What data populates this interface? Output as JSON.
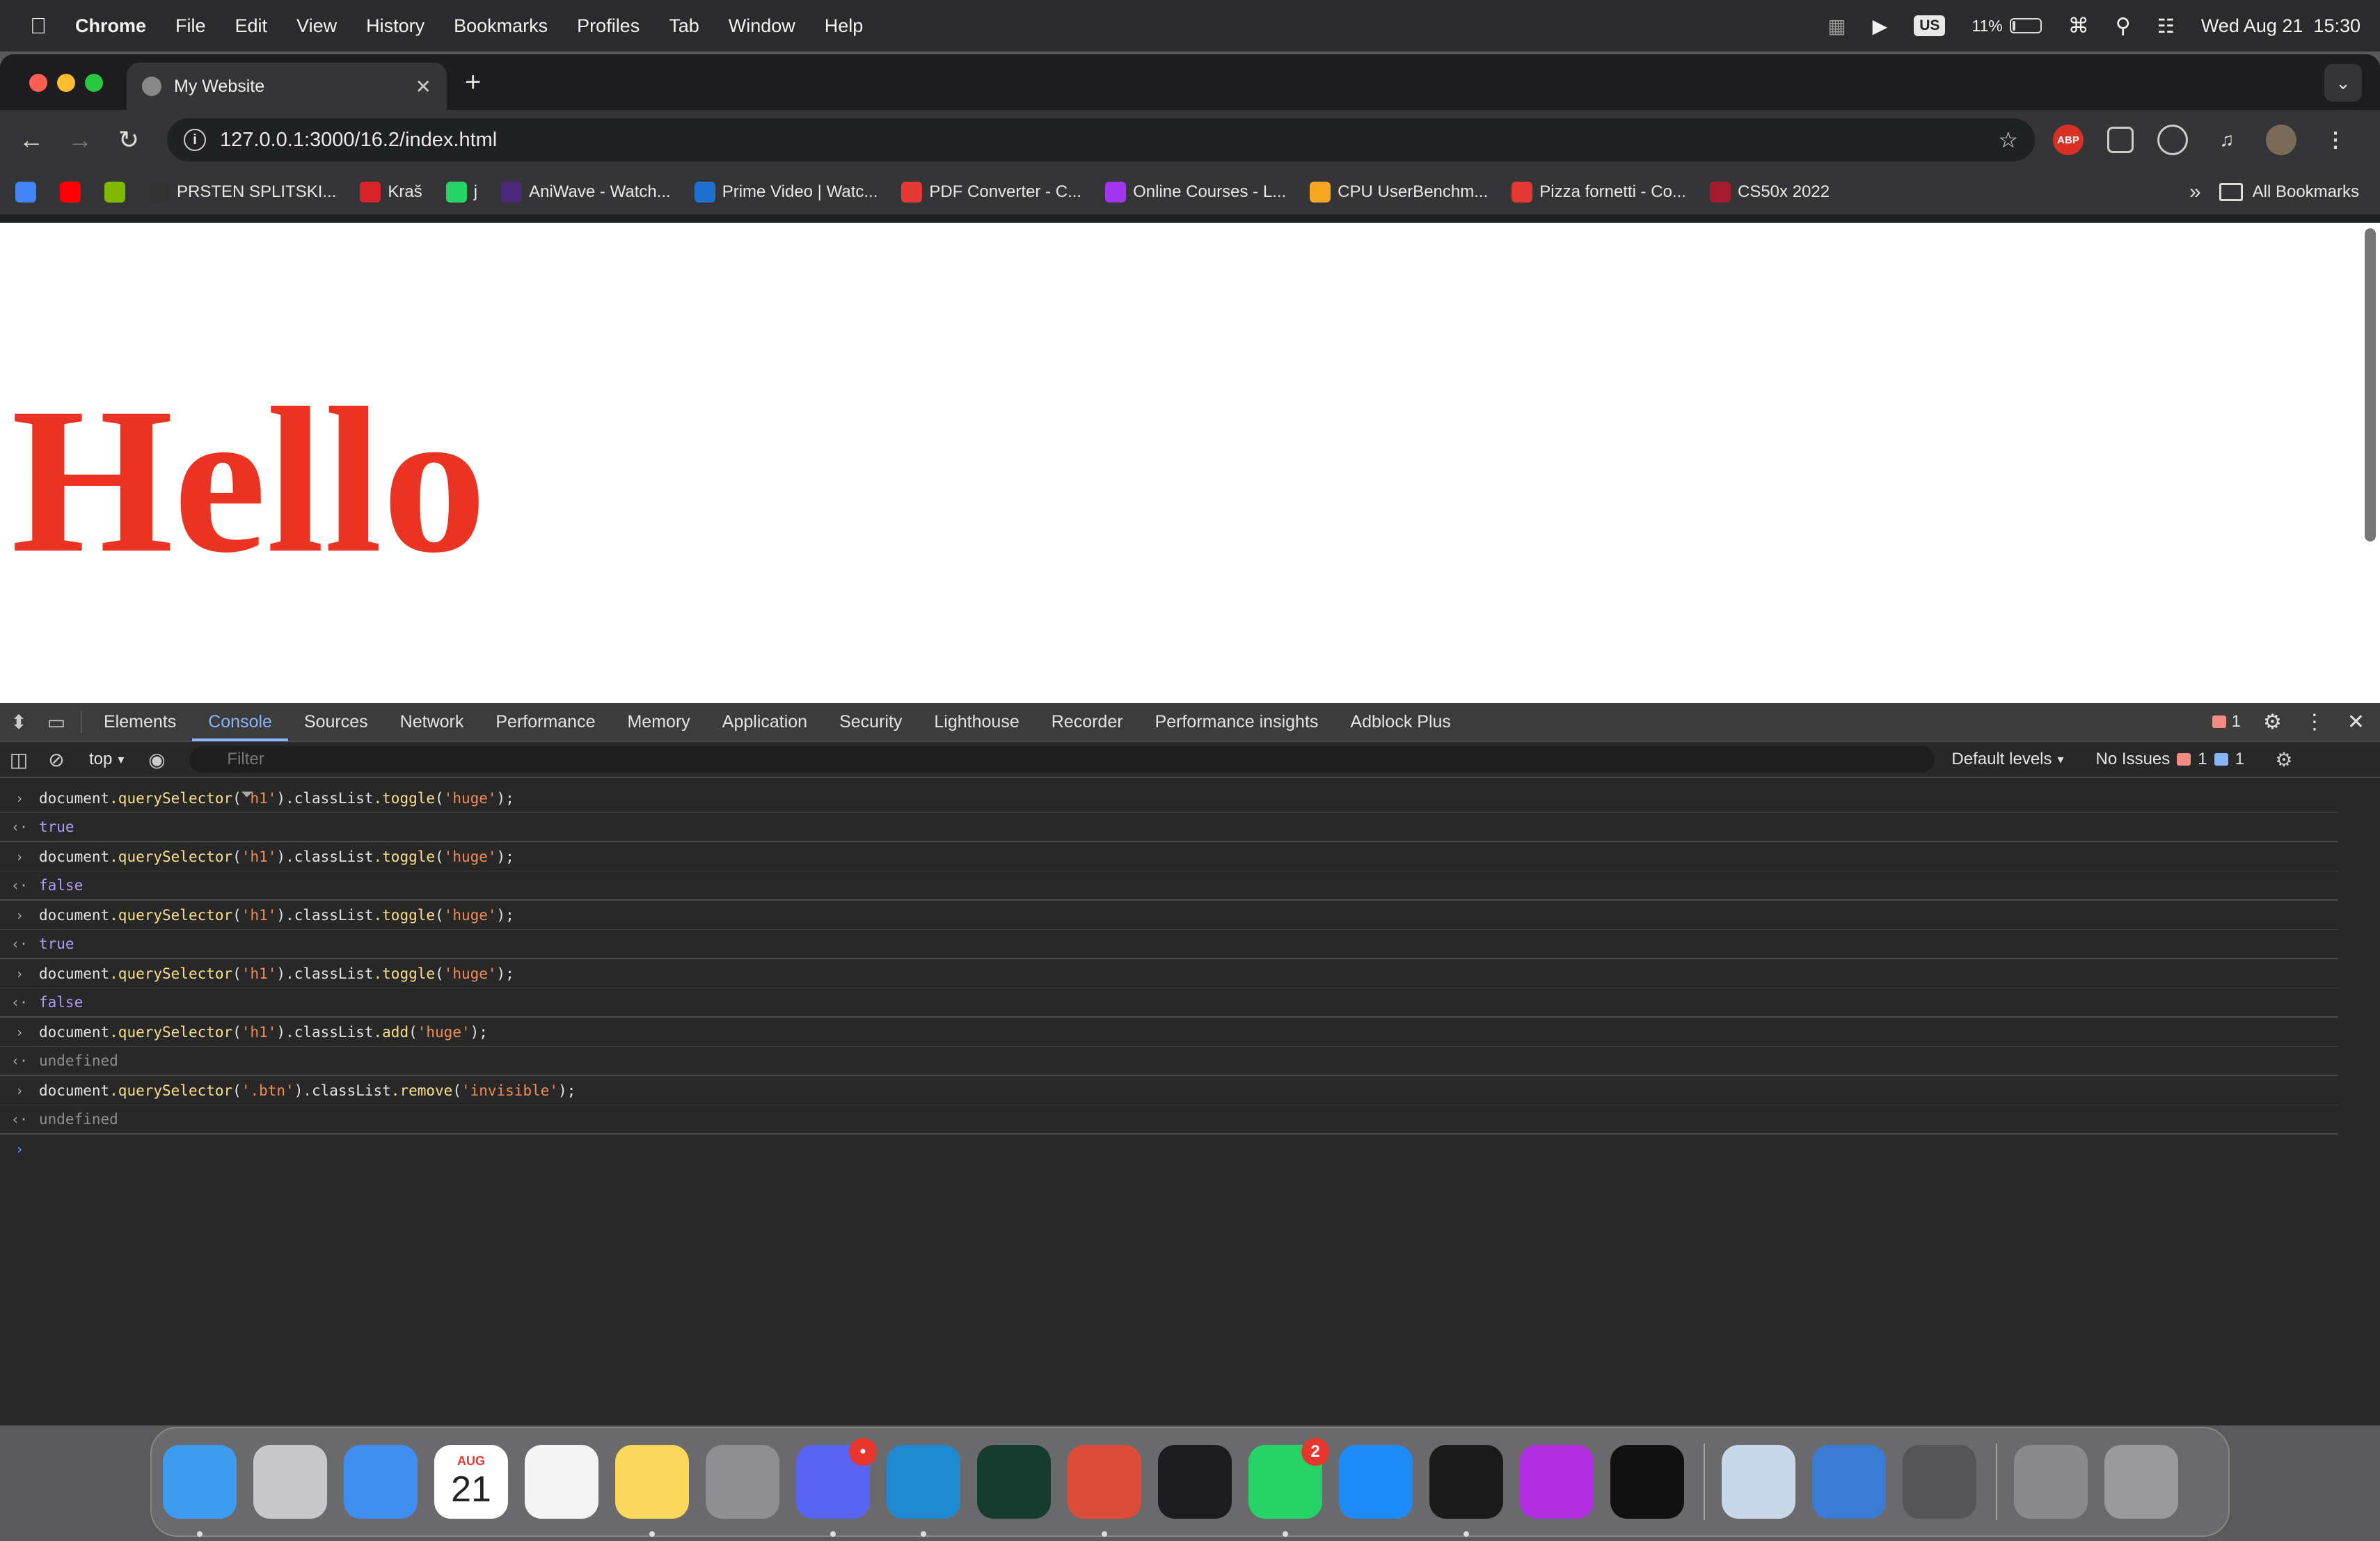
{
  "menubar": {
    "app_name": "Chrome",
    "items": [
      "File",
      "Edit",
      "View",
      "History",
      "Bookmarks",
      "Profiles",
      "Tab",
      "Window",
      "Help"
    ],
    "input_source": "US",
    "battery_text": "11%",
    "battery_level": 0.11,
    "datetime": "Wed Aug 21  15:30"
  },
  "browser": {
    "tab_title": "My Website",
    "url": "127.0.0.1:3000/16.2/index.html",
    "bookmarks": [
      {
        "label": "",
        "icon": "google-icon",
        "color": "#4285f4"
      },
      {
        "label": "",
        "icon": "youtube-icon",
        "color": "#ff0000"
      },
      {
        "label": "",
        "icon": "microsoft-icon",
        "color": "#7fba00"
      },
      {
        "label": "PRSTEN SPLITSKI...",
        "icon": "prsten-icon",
        "color": "#333333"
      },
      {
        "label": "Kraš",
        "icon": "kras-icon",
        "color": "#d8232a"
      },
      {
        "label": "j",
        "icon": "whatsapp-icon",
        "color": "#25d366"
      },
      {
        "label": "AniWave - Watch...",
        "icon": "aniwave-icon",
        "color": "#4b2a7b"
      },
      {
        "label": "Prime Video | Watc...",
        "icon": "prime-video-icon",
        "color": "#1f6fd1"
      },
      {
        "label": "PDF Converter - C...",
        "icon": "pdf-converter-icon",
        "color": "#e53935"
      },
      {
        "label": "Online Courses - L...",
        "icon": "udemy-icon",
        "color": "#a435f0"
      },
      {
        "label": "CPU UserBenchm...",
        "icon": "userbenchmark-icon",
        "color": "#f5a623"
      },
      {
        "label": "Pizza fornetti - Co...",
        "icon": "heart-icon",
        "color": "#e53935"
      },
      {
        "label": "CS50x 2022",
        "icon": "harvard-icon",
        "color": "#a51c30"
      }
    ],
    "all_bookmarks_label": "All Bookmarks"
  },
  "page": {
    "heading": "Hello",
    "heading_color": "#ea3323"
  },
  "devtools": {
    "tabs": [
      "Elements",
      "Console",
      "Sources",
      "Network",
      "Performance",
      "Memory",
      "Application",
      "Security",
      "Lighthouse",
      "Recorder",
      "Performance insights",
      "Adblock Plus"
    ],
    "active_tab": "Console",
    "error_count": "1",
    "context": "top",
    "filter_placeholder": "Filter",
    "levels_label": "Default levels",
    "issues_label": "No Issues",
    "issues_errors": "1",
    "issues_info": "1",
    "console": [
      {
        "in": "document.querySelector('h1').classList.toggle('huge');",
        "out": "true"
      },
      {
        "in": "document.querySelector('h1').classList.toggle('huge');",
        "out": "false"
      },
      {
        "in": "document.querySelector('h1').classList.toggle('huge');",
        "out": "true"
      },
      {
        "in": "document.querySelector('h1').classList.toggle('huge');",
        "out": "false"
      },
      {
        "in": "document.querySelector('h1').classList.add('huge');",
        "out": "undefined"
      },
      {
        "in": "document.querySelector('.btn').classList.remove('invisible');",
        "out": "undefined"
      }
    ]
  },
  "dock": {
    "apps": [
      {
        "icon": "finder-icon",
        "color": "#3d9bf0",
        "running": true
      },
      {
        "icon": "launchpad-icon",
        "color": "#c8c8cc",
        "running": false
      },
      {
        "icon": "mail-icon",
        "color": "#3f8ef0",
        "running": false
      },
      {
        "icon": "calendar-icon",
        "color": "#ffffff",
        "running": false,
        "month": "AUG",
        "day": "21"
      },
      {
        "icon": "reminders-icon",
        "color": "#f4f4f4",
        "running": false
      },
      {
        "icon": "notes-icon",
        "color": "#fbd75b",
        "running": true
      },
      {
        "icon": "system-settings-icon",
        "color": "#8e8e93",
        "running": false
      },
      {
        "icon": "discord-icon",
        "color": "#5865f2",
        "running": true,
        "badge": "•"
      },
      {
        "icon": "vscode-icon",
        "color": "#1f8ad2",
        "running": true
      },
      {
        "icon": "perplexity-icon",
        "color": "#163b2f",
        "running": false
      },
      {
        "icon": "chrome-icon",
        "color": "#dd4b39",
        "running": true
      },
      {
        "icon": "terminal-icon",
        "color": "#1c1c1e",
        "running": false
      },
      {
        "icon": "whatsapp-icon",
        "color": "#25d366",
        "running": true,
        "badge": "2"
      },
      {
        "icon": "app-store-icon",
        "color": "#1d8cf8",
        "running": false
      },
      {
        "icon": "activity-monitor-icon",
        "color": "#1a1a1a",
        "running": true
      },
      {
        "icon": "wps-office-icon",
        "color": "#b12de0",
        "running": false
      },
      {
        "icon": "chatgpt-icon",
        "color": "#111111",
        "running": false
      },
      {
        "icon": "preview-icon",
        "color": "#c9d8e8",
        "running": false
      },
      {
        "icon": "weather-icon",
        "color": "#3a7bd5",
        "running": false
      },
      {
        "icon": "calculator-icon",
        "color": "#555558",
        "running": false
      },
      {
        "icon": "downloads-stack-icon",
        "color": "#8a8a8e",
        "running": false
      },
      {
        "icon": "trash-icon",
        "color": "#9a9a9e",
        "running": false
      }
    ]
  }
}
